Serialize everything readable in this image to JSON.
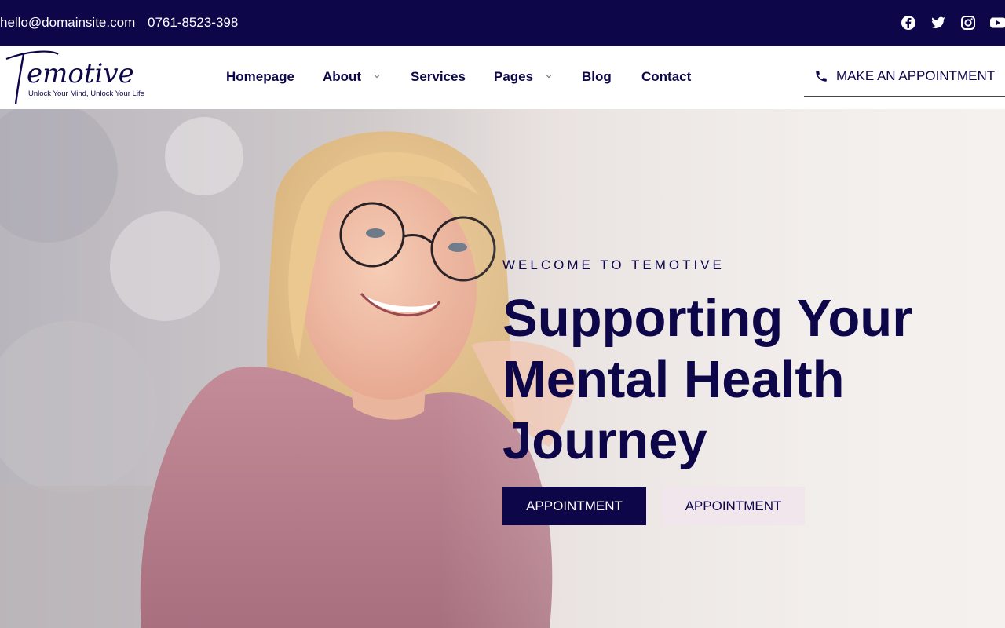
{
  "topbar": {
    "email": "hello@domainsite.com",
    "phone": "0761-8523-398",
    "social": [
      "facebook-icon",
      "twitter-icon",
      "instagram-icon",
      "youtube-icon"
    ]
  },
  "logo": {
    "name": "Temotive",
    "tagline": "Unlock Your Mind, Unlock Your Life"
  },
  "nav": {
    "items": [
      {
        "label": "Homepage"
      },
      {
        "label": "About",
        "has_dropdown": true
      },
      {
        "label": "Services"
      },
      {
        "label": "Pages",
        "has_dropdown": true
      },
      {
        "label": "Blog"
      },
      {
        "label": "Contact"
      }
    ],
    "appointment_label": "MAKE AN APPOINTMENT"
  },
  "hero": {
    "eyebrow": "WELCOME TO TEMOTIVE",
    "headline": "Supporting Your Mental Health Journey",
    "buttons": [
      {
        "label": "APPOINTMENT"
      },
      {
        "label": "APPOINTMENT"
      }
    ]
  },
  "colors": {
    "navy": "#0d0649",
    "secondary_button_bg": "#f0e6ec"
  }
}
